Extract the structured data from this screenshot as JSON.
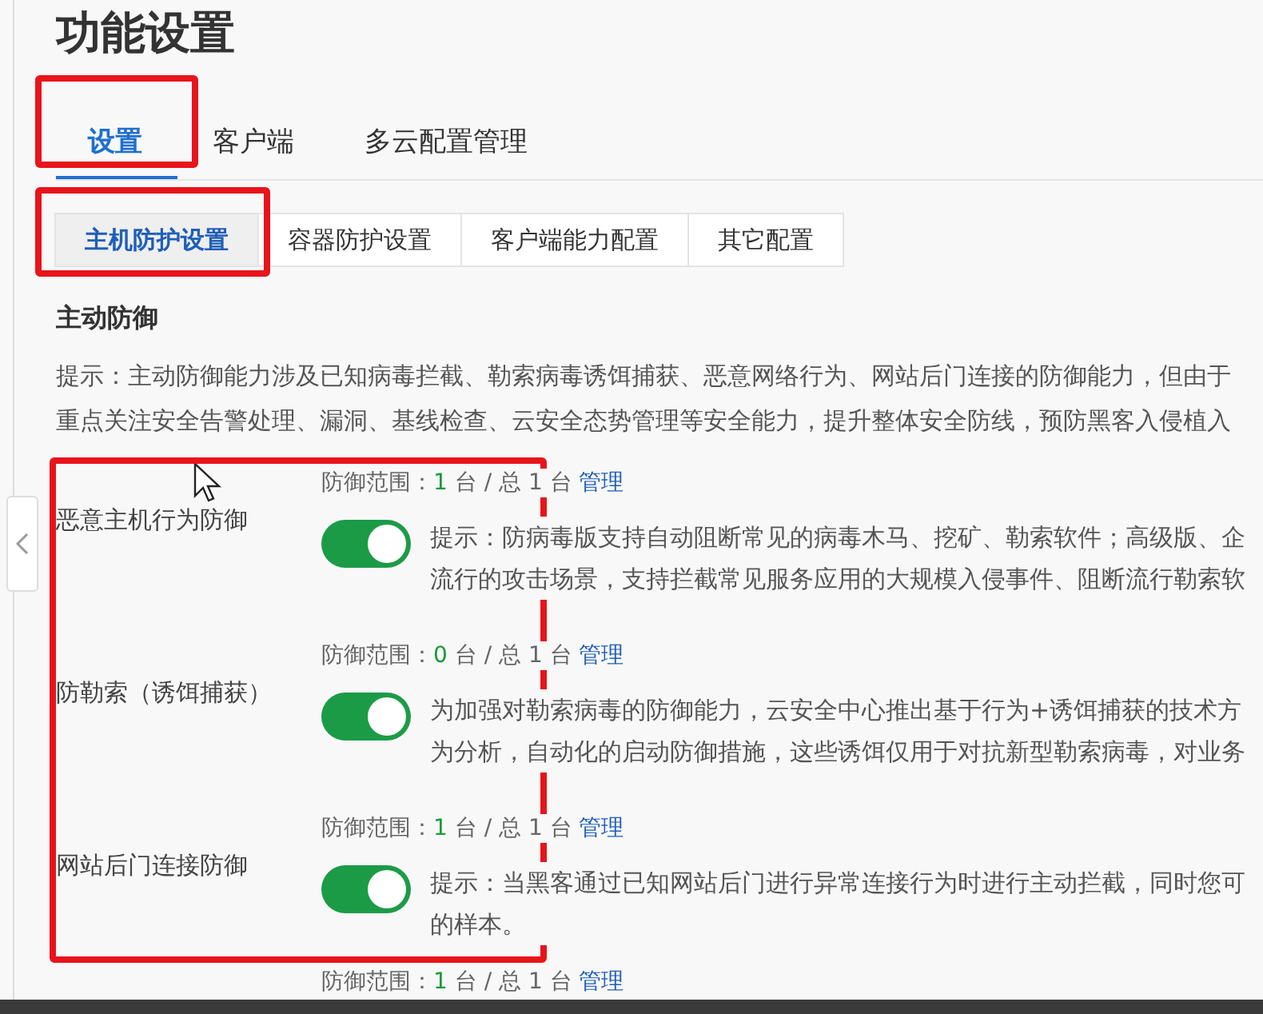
{
  "title": "功能设置",
  "tabs": [
    {
      "label": "设置",
      "selected": true
    },
    {
      "label": "客户端",
      "selected": false
    },
    {
      "label": "多云配置管理",
      "selected": false
    }
  ],
  "subtabs": [
    {
      "label": "主机防护设置",
      "selected": true
    },
    {
      "label": "容器防护设置",
      "selected": false
    },
    {
      "label": "客户端能力配置",
      "selected": false
    },
    {
      "label": "其它配置",
      "selected": false
    }
  ],
  "section": {
    "heading": "主动防御",
    "intro": [
      "提示：主动防御能力涉及已知病毒拦截、勒索病毒诱饵捕获、恶意网络行为、网站后门连接的防御能力，但由于",
      "重点关注安全告警处理、漏洞、基线检查、云安全态势管理等安全能力，提升整体安全防线，预防黑客入侵植入"
    ]
  },
  "rows": [
    {
      "label": "恶意主机行为防御",
      "scope_label": "防御范围：",
      "protected": "1",
      "scope_middle": "台 / 总",
      "total": "1",
      "scope_unit": "台",
      "manage": "管理",
      "on": true,
      "hint": [
        "提示：防病毒版支持自动阻断常见的病毒木马、挖矿、勒索软件；高级版、企",
        "流行的攻击场景，支持拦截常见服务应用的大规模入侵事件、阻断流行勒索软"
      ]
    },
    {
      "label": "防勒索（诱饵捕获）",
      "scope_label": "防御范围：",
      "protected": "0",
      "scope_middle": "台 / 总",
      "total": "1",
      "scope_unit": "台",
      "manage": "管理",
      "on": true,
      "hint": [
        "为加强对勒索病毒的防御能力，云安全中心推出基于行为+诱饵捕获的技术方",
        "为分析，自动化的启动防御措施，这些诱饵仅用于对抗新型勒索病毒，对业务"
      ]
    },
    {
      "label": "网站后门连接防御",
      "scope_label": "防御范围：",
      "protected": "1",
      "scope_middle": "台 / 总",
      "total": "1",
      "scope_unit": "台",
      "manage": "管理",
      "on": true,
      "hint": [
        "提示：当黑客通过已知网站后门进行异常连接行为时进行主动拦截，同时您可",
        "的样本。"
      ]
    },
    {
      "scope_label": "防御范围：",
      "protected": "1",
      "scope_middle": "台 / 总",
      "total": "1",
      "scope_unit": "台",
      "manage": "管理"
    }
  ]
}
